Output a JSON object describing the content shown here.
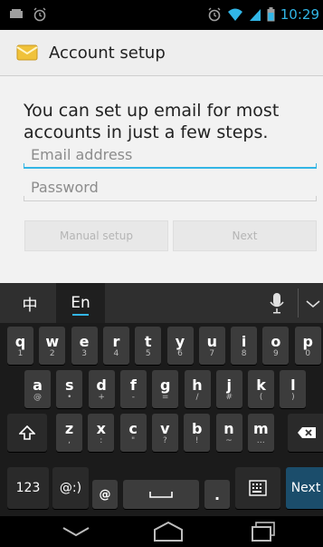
{
  "status_bar": {
    "time": "10:29",
    "icons": [
      "sd-card-icon",
      "alarm-icon",
      "alarm-icon",
      "wifi-icon",
      "signal-icon",
      "battery-icon"
    ]
  },
  "action_bar": {
    "title": "Account setup",
    "icon": "email-envelope-icon"
  },
  "content": {
    "intro": "You can set up email for most accounts in just a few steps.",
    "email_field": {
      "placeholder": "Email address",
      "value": ""
    },
    "password_field": {
      "placeholder": "Password",
      "value": ""
    },
    "manual_setup_label": "Manual setup",
    "next_label": "Next"
  },
  "keyboard": {
    "lang_zh": "中",
    "lang_en": "En",
    "row1": [
      {
        "main": "q",
        "sub": "1"
      },
      {
        "main": "w",
        "sub": "2"
      },
      {
        "main": "e",
        "sub": "3"
      },
      {
        "main": "r",
        "sub": "4"
      },
      {
        "main": "t",
        "sub": "5"
      },
      {
        "main": "y",
        "sub": "6"
      },
      {
        "main": "u",
        "sub": "7"
      },
      {
        "main": "i",
        "sub": "8"
      },
      {
        "main": "o",
        "sub": "9"
      },
      {
        "main": "p",
        "sub": "0"
      }
    ],
    "row2": [
      {
        "main": "a",
        "sub": "@"
      },
      {
        "main": "s",
        "sub": "•"
      },
      {
        "main": "d",
        "sub": "+"
      },
      {
        "main": "f",
        "sub": "-"
      },
      {
        "main": "g",
        "sub": "="
      },
      {
        "main": "h",
        "sub": "/"
      },
      {
        "main": "j",
        "sub": "#"
      },
      {
        "main": "k",
        "sub": "("
      },
      {
        "main": "l",
        "sub": ")"
      }
    ],
    "row3": [
      {
        "main": "z",
        "sub": ","
      },
      {
        "main": "x",
        "sub": ":"
      },
      {
        "main": "c",
        "sub": "\""
      },
      {
        "main": "v",
        "sub": "?"
      },
      {
        "main": "b",
        "sub": "!"
      },
      {
        "main": "n",
        "sub": "~"
      },
      {
        "main": "m",
        "sub": "…"
      }
    ],
    "key_123": "123",
    "key_emoji": "@:)",
    "key_at": "@",
    "key_dot": ".",
    "key_next": "Next"
  },
  "colors": {
    "accent": "#33b5e5",
    "keyboard_bg": "#1b1b1b",
    "key_bg": "#3c3c3c"
  }
}
